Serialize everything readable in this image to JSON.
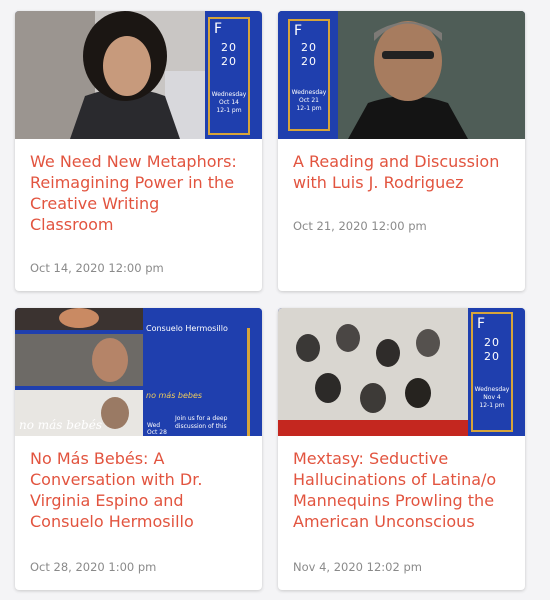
{
  "events": [
    {
      "title": "We Need New Metaphors: Reimagining Power in the Creative Writing Classroom",
      "date": "Oct 14, 2020 12:00 pm",
      "badge": {
        "letter": "F",
        "year_a": "20",
        "year_b": "20",
        "day": "Wednesday",
        "date": "Oct 14",
        "time": "12-1 pm"
      }
    },
    {
      "title": "A Reading and Discussion with Luis J. Rodriguez",
      "date": "Oct 21, 2020 12:00 pm",
      "badge": {
        "letter": "F",
        "year_a": "20",
        "year_b": "20",
        "day": "Wednesday",
        "date": "Oct 21",
        "time": "12-1 pm"
      }
    },
    {
      "title": "No Más Bebés: A Conversation with Dr. Virginia Espino and Consuelo Hermosillo",
      "date": "Oct 28, 2020 1:00 pm",
      "flyer": {
        "name": "Consuelo Hermosillo",
        "film": "no más bebes",
        "overlay": "no más bebés",
        "blurb": "Join us for a deep discussion of this",
        "wed": "Wed",
        "oct": "Oct 28"
      }
    },
    {
      "title": "Mextasy: Seductive Hallucinations of Latina/o Mannequins Prowling the American Unconscious",
      "date": "Nov 4, 2020 12:02 pm",
      "badge": {
        "letter": "F",
        "year_a": "20",
        "year_b": "20",
        "day": "Wednesday",
        "date": "Nov 4",
        "time": "12-1 pm"
      }
    }
  ],
  "colors": {
    "title": "#e2543f",
    "flyer_blue": "#1f3fae",
    "gold": "#d6a43a",
    "date": "#8a8a8a"
  }
}
